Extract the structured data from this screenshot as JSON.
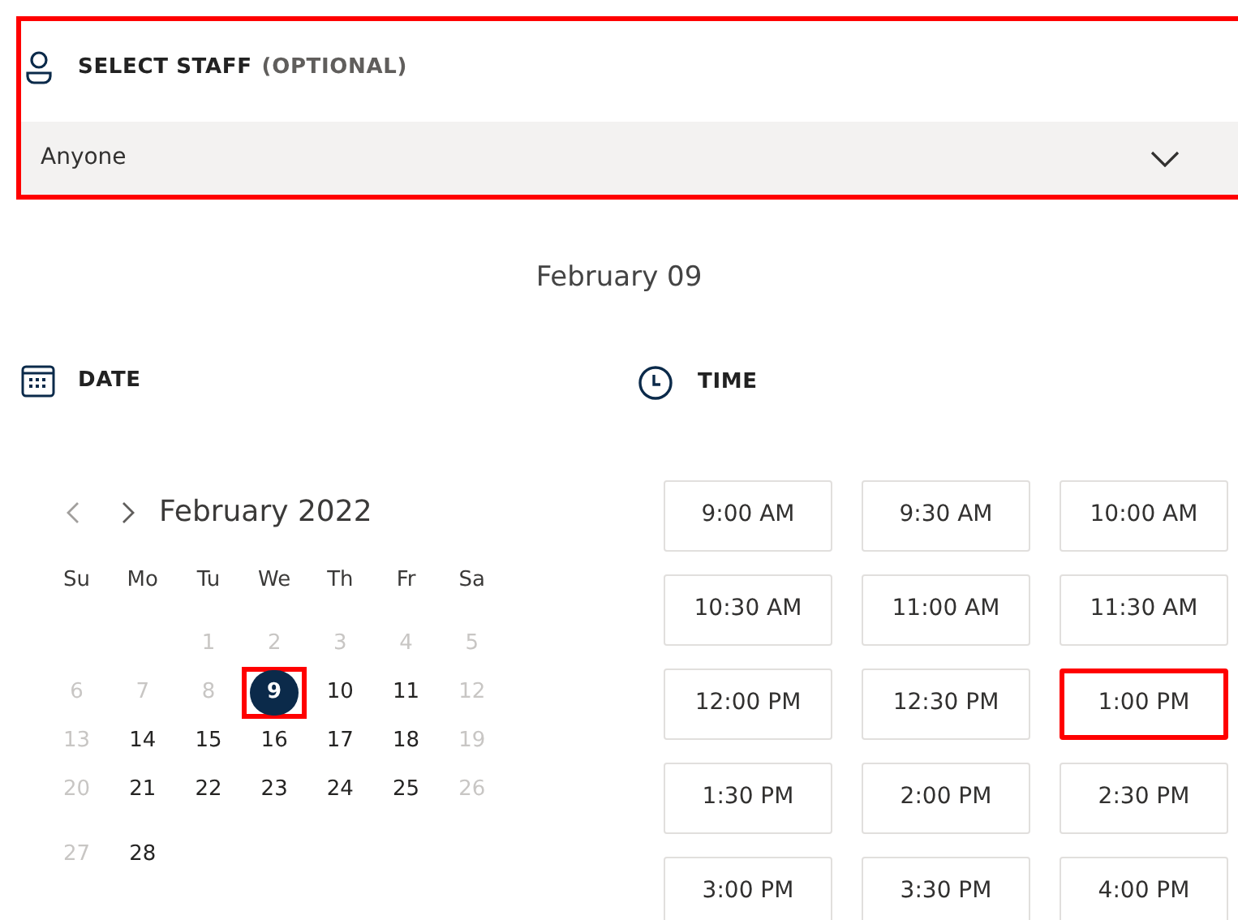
{
  "staff": {
    "label": "SELECT STAFF",
    "hint": "(OPTIONAL)",
    "value": "Anyone",
    "highlighted": true
  },
  "selected_date": "February 09",
  "date_section": {
    "label": "DATE"
  },
  "time_section": {
    "label": "TIME"
  },
  "calendar": {
    "month": "February 2022",
    "weekdays": [
      "Su",
      "Mo",
      "Tu",
      "We",
      "Th",
      "Fr",
      "Sa"
    ],
    "weeks": [
      [
        {
          "label": "1",
          "available": false,
          "selected": false,
          "highlighted": false
        },
        {
          "label": "2",
          "available": false,
          "selected": false,
          "highlighted": false
        },
        {
          "label": "3",
          "available": false,
          "selected": false,
          "highlighted": false
        },
        {
          "label": "4",
          "available": false,
          "selected": false,
          "highlighted": false
        },
        {
          "label": "5",
          "available": false,
          "selected": false,
          "highlighted": false
        }
      ],
      [
        {
          "label": "6",
          "available": false,
          "selected": false,
          "highlighted": false
        },
        {
          "label": "7",
          "available": false,
          "selected": false,
          "highlighted": false
        },
        {
          "label": "8",
          "available": false,
          "selected": false,
          "highlighted": false
        },
        {
          "label": "9",
          "available": true,
          "selected": true,
          "highlighted": true
        },
        {
          "label": "10",
          "available": true,
          "selected": false,
          "highlighted": false
        },
        {
          "label": "11",
          "available": true,
          "selected": false,
          "highlighted": false
        },
        {
          "label": "12",
          "available": false,
          "selected": false,
          "highlighted": false
        }
      ],
      [
        {
          "label": "13",
          "available": false,
          "selected": false,
          "highlighted": false
        },
        {
          "label": "14",
          "available": true,
          "selected": false,
          "highlighted": false
        },
        {
          "label": "15",
          "available": true,
          "selected": false,
          "highlighted": false
        },
        {
          "label": "16",
          "available": true,
          "selected": false,
          "highlighted": false
        },
        {
          "label": "17",
          "available": true,
          "selected": false,
          "highlighted": false
        },
        {
          "label": "18",
          "available": true,
          "selected": false,
          "highlighted": false
        },
        {
          "label": "19",
          "available": false,
          "selected": false,
          "highlighted": false
        }
      ],
      [
        {
          "label": "20",
          "available": false,
          "selected": false,
          "highlighted": false
        },
        {
          "label": "21",
          "available": true,
          "selected": false,
          "highlighted": false
        },
        {
          "label": "22",
          "available": true,
          "selected": false,
          "highlighted": false
        },
        {
          "label": "23",
          "available": true,
          "selected": false,
          "highlighted": false
        },
        {
          "label": "24",
          "available": true,
          "selected": false,
          "highlighted": false
        },
        {
          "label": "25",
          "available": true,
          "selected": false,
          "highlighted": false
        },
        {
          "label": "26",
          "available": false,
          "selected": false,
          "highlighted": false
        }
      ],
      [
        {
          "label": "27",
          "available": false,
          "selected": false,
          "highlighted": false
        },
        {
          "label": "28",
          "available": true,
          "selected": false,
          "highlighted": false
        }
      ]
    ]
  },
  "time_slots": [
    {
      "label": "9:00 AM",
      "highlighted": false
    },
    {
      "label": "9:30 AM",
      "highlighted": false
    },
    {
      "label": "10:00 AM",
      "highlighted": false
    },
    {
      "label": "10:30 AM",
      "highlighted": false
    },
    {
      "label": "11:00 AM",
      "highlighted": false
    },
    {
      "label": "11:30 AM",
      "highlighted": false
    },
    {
      "label": "12:00 PM",
      "highlighted": false
    },
    {
      "label": "12:30 PM",
      "highlighted": false
    },
    {
      "label": "1:00 PM",
      "highlighted": true
    },
    {
      "label": "1:30 PM",
      "highlighted": false
    },
    {
      "label": "2:00 PM",
      "highlighted": false
    },
    {
      "label": "2:30 PM",
      "highlighted": false
    },
    {
      "label": "3:00 PM",
      "highlighted": false
    },
    {
      "label": "3:30 PM",
      "highlighted": false
    },
    {
      "label": "4:00 PM",
      "highlighted": false
    }
  ]
}
